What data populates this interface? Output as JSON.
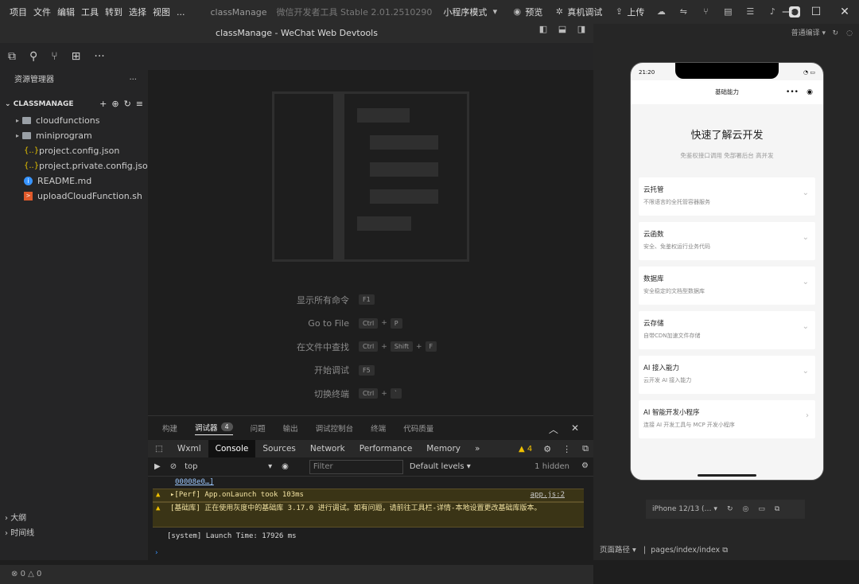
{
  "menubar": {
    "items": [
      "项目",
      "文件",
      "编辑",
      "工具",
      "转到",
      "选择",
      "视图",
      "..."
    ]
  },
  "titlebar": {
    "project": "classManage",
    "app": "微信开发者工具 Stable 2.01.2510290",
    "mode": "小程序模式",
    "preview": "预览",
    "remote_debug": "真机调试",
    "upload": "上传"
  },
  "editor": {
    "title": "classManage - WeChat Web Devtools"
  },
  "explorer": {
    "header": "资源管理器",
    "project": "CLASSMANAGE",
    "items": [
      {
        "name": "cloudfunctions",
        "type": "folder"
      },
      {
        "name": "miniprogram",
        "type": "folder"
      },
      {
        "name": "project.config.json",
        "type": "json"
      },
      {
        "name": "project.private.config.json",
        "type": "json"
      },
      {
        "name": "README.md",
        "type": "info"
      },
      {
        "name": "uploadCloudFunction.sh",
        "type": "sh"
      }
    ],
    "outline": "大纲",
    "timeline": "时间线"
  },
  "statusbar": {
    "errors": "0",
    "warnings": "0"
  },
  "welcome": {
    "shortcuts": [
      {
        "label": "显示所有命令",
        "keys": [
          "F1"
        ]
      },
      {
        "label": "Go to File",
        "keys": [
          "Ctrl",
          "P"
        ]
      },
      {
        "label": "在文件中查找",
        "keys": [
          "Ctrl",
          "Shift",
          "F"
        ]
      },
      {
        "label": "开始调试",
        "keys": [
          "F5"
        ]
      },
      {
        "label": "切换终端",
        "keys": [
          "Ctrl",
          "`"
        ]
      }
    ]
  },
  "panel": {
    "tabs": [
      "构建",
      "调试器",
      "问题",
      "输出",
      "调试控制台",
      "终端",
      "代码质量"
    ],
    "active_tab": "调试器",
    "debugger_badge": "4",
    "devtools_tabs": [
      "Wxml",
      "Console",
      "Sources",
      "Network",
      "Performance",
      "Memory"
    ],
    "active_devtools_tab": "Console",
    "warn_count": "4",
    "context": "top",
    "filter_placeholder": "Filter",
    "levels": "Default levels",
    "hidden": "1 hidden",
    "logs": [
      {
        "type": "plain",
        "text": "00008e0…]"
      },
      {
        "type": "warn",
        "text": "▸[Perf] App.onLaunch took 103ms",
        "source": "app.js:2"
      },
      {
        "type": "warn",
        "text": "[基础库] 正在使用灰度中的基础库 3.17.0 进行调试。如有问题，请前往工具栏-详情-本地设置更改基础库版本。",
        "source": ""
      },
      {
        "type": "plain",
        "text": "[system] Launch Time: 17926 ms"
      }
    ],
    "prompt": "›"
  },
  "simulator": {
    "compile_mode": "普通编译",
    "time": "21:20",
    "nav_title": "基础能力",
    "title": "快速了解云开发",
    "subtitle": "免鉴权接口调用 免部署后台 高并发",
    "cards": [
      {
        "title": "云托管",
        "desc": "不限语言的全托管容器服务"
      },
      {
        "title": "云函数",
        "desc": "安全、免鉴权运行业务代码"
      },
      {
        "title": "数据库",
        "desc": "安全稳定的文档型数据库"
      },
      {
        "title": "云存储",
        "desc": "自带CDN加速文件存储"
      },
      {
        "title": "AI 接入能力",
        "desc": "云开发 AI 接入能力"
      },
      {
        "title": "AI 智能开发小程序",
        "desc": "连接 AI 开发工具与 MCP 开发小程序"
      }
    ],
    "device": "iPhone 12/13 (…",
    "page_path_label": "页面路径",
    "page_path": "pages/index/index"
  }
}
